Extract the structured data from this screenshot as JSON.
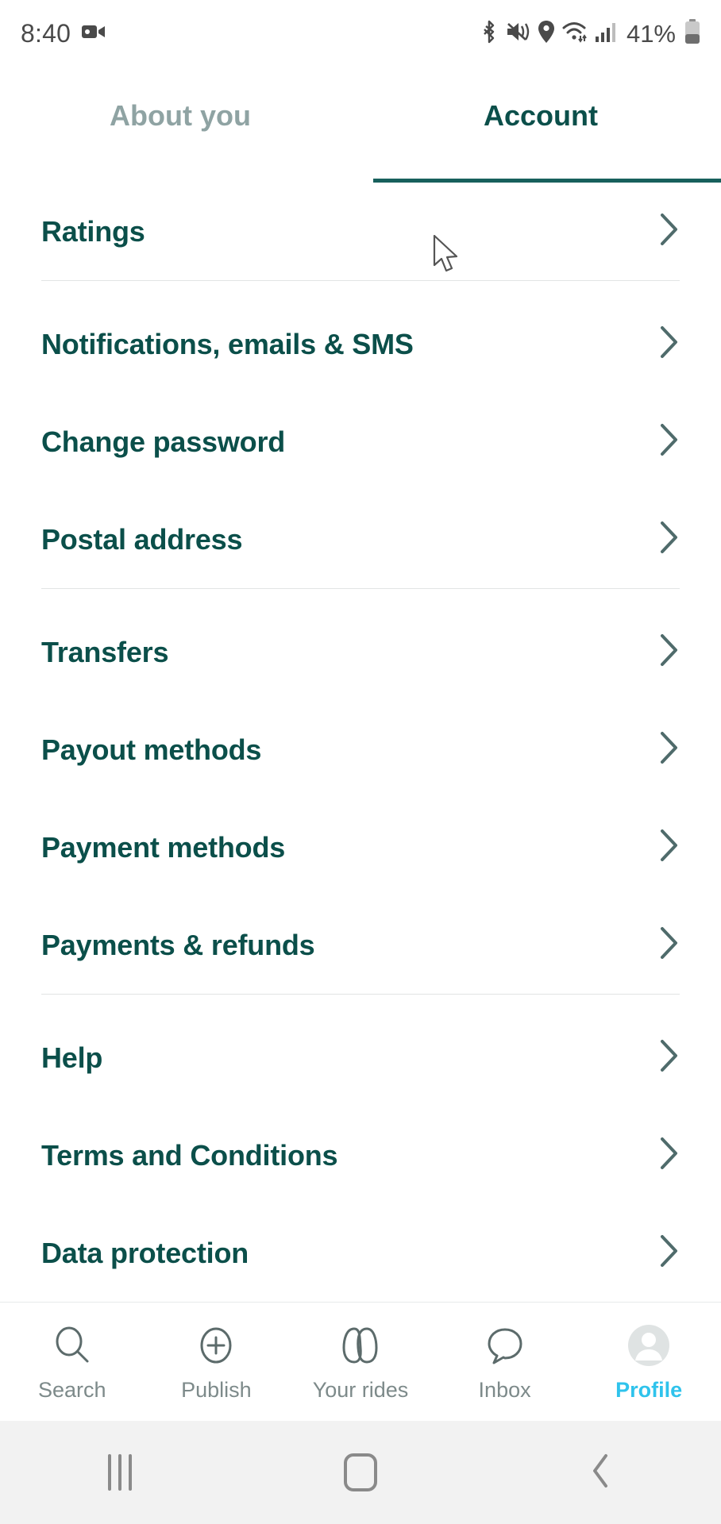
{
  "statusbar": {
    "time": "8:40",
    "battery_percent": "41%",
    "icons": [
      "screen-recorder-icon",
      "bluetooth-icon",
      "vibrate-icon",
      "location-icon",
      "wifi-icon",
      "cellular-signal-icon",
      "battery-icon"
    ]
  },
  "tabs": [
    {
      "label": "About you",
      "active": false
    },
    {
      "label": "Account",
      "active": true
    }
  ],
  "groups": [
    {
      "items": [
        {
          "label": "Ratings"
        }
      ]
    },
    {
      "items": [
        {
          "label": "Notifications, emails & SMS"
        },
        {
          "label": "Change password"
        },
        {
          "label": "Postal address"
        }
      ]
    },
    {
      "items": [
        {
          "label": "Transfers"
        },
        {
          "label": "Payout methods"
        },
        {
          "label": "Payment methods"
        },
        {
          "label": "Payments & refunds"
        }
      ]
    },
    {
      "items": [
        {
          "label": "Help"
        },
        {
          "label": "Terms and Conditions"
        },
        {
          "label": "Data protection"
        }
      ]
    }
  ],
  "bottom_nav": [
    {
      "label": "Search",
      "icon": "search-icon",
      "active": false
    },
    {
      "label": "Publish",
      "icon": "plus-circle-icon",
      "active": false
    },
    {
      "label": "Your rides",
      "icon": "rides-icon",
      "active": false
    },
    {
      "label": "Inbox",
      "icon": "chat-bubble-icon",
      "active": false
    },
    {
      "label": "Profile",
      "icon": "avatar-icon",
      "active": true
    }
  ],
  "system_nav": [
    {
      "name": "recents-button"
    },
    {
      "name": "home-button"
    },
    {
      "name": "back-button"
    }
  ],
  "colors": {
    "primary_teal": "#0b4f4a",
    "tab_inactive": "#8fa3a3",
    "tab_underline": "#17605c",
    "accent_cyan": "#2fc3ec",
    "divider": "#e2e4e4",
    "status_gray": "#4a4a4a"
  }
}
